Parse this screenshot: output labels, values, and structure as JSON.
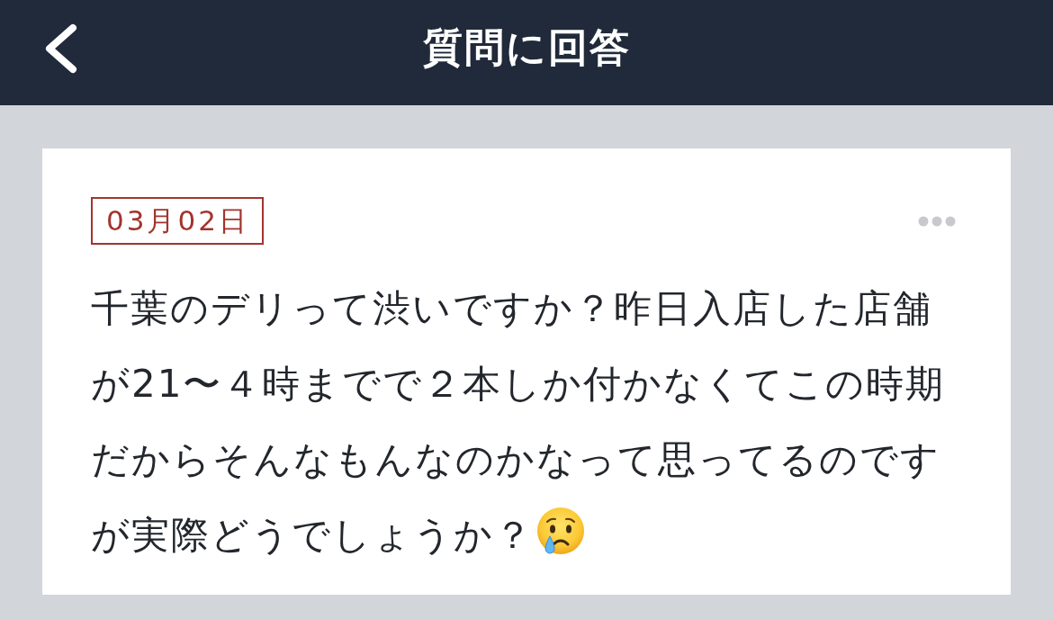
{
  "header": {
    "title": "質問に回答"
  },
  "question": {
    "date": "03月02日",
    "text": "千葉のデリって渋いですか？昨日入店した店舗が21〜４時までで２本しか付かなくてこの時期だからそんなもんなのかなって思ってるのですが実際どうでしょうか？"
  }
}
